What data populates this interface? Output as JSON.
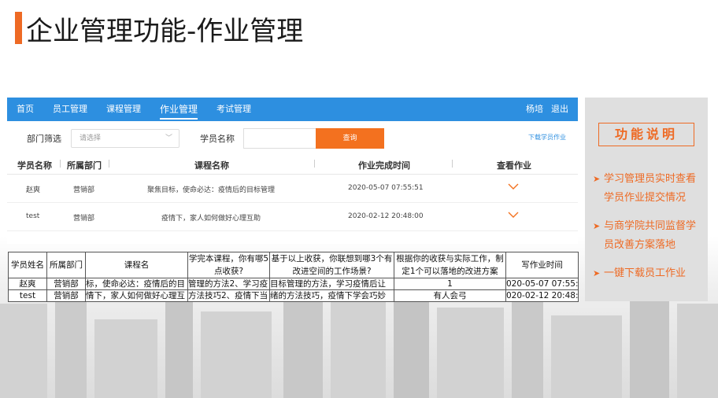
{
  "slide": {
    "title": "企业管理功能-作业管理"
  },
  "nav": {
    "items": [
      "首页",
      "员工管理",
      "课程管理",
      "作业管理",
      "考试管理"
    ],
    "active": "作业管理",
    "user": "杨培",
    "logout": "退出"
  },
  "filter": {
    "dept_label": "部门筛选",
    "dept_placeholder": "请选择",
    "name_label": "学员名称",
    "name_value": "",
    "query_button": "查询",
    "download_link": "下载学员作业"
  },
  "table": {
    "headers": [
      "学员名称",
      "所属部门",
      "课程名称",
      "作业完成时间",
      "查看作业"
    ],
    "rows": [
      {
        "name": "赵爽",
        "dept": "营销部",
        "course": "聚焦目标，使命必达：疫情后的目标管理",
        "time": "2020-05-07 07:55:51"
      },
      {
        "name": "test",
        "dept": "营销部",
        "course": "疫情下，家人如何做好心理互助",
        "time": "2020-02-12 20:48:00"
      }
    ]
  },
  "export_sheet": {
    "headers": [
      "学员姓名",
      "所属部门",
      "课程名",
      "学完本课程，你有哪5点收获?",
      "基于以上收获，你联想到哪3个有改进空间的工作场景?",
      "根据你的收获与实际工作，制定1个可以落地的改进方案",
      "写作业时间"
    ],
    "rows": [
      [
        "赵爽",
        "营销部",
        "标，使命必达：疫情后的目",
        "管理的方法2、学习疫",
        "目标管理的方法，学习疫情后让",
        "1",
        "020-05-07 07:55:5"
      ],
      [
        "test",
        "营销部",
        "情下，家人如何做好心理互",
        "方法技巧2、疫情下当",
        "绪的方法技巧，疫情下学会巧妙",
        "有人会弓",
        "020-02-12 20:48:0"
      ]
    ]
  },
  "side_panel": {
    "title": "功能说明",
    "items": [
      {
        "line1": "学习管理员实时查看",
        "line2": "学员作业提交情况"
      },
      {
        "line1": "与商学院共同监督学",
        "line2": "员改善方案落地"
      },
      {
        "line1": "一键下载员工作业",
        "line2": ""
      }
    ],
    "arrow_icon": "➤"
  },
  "colors": {
    "accent": "#ee6a24",
    "nav_blue": "#2d8fe0",
    "query_orange": "#f3711f"
  }
}
